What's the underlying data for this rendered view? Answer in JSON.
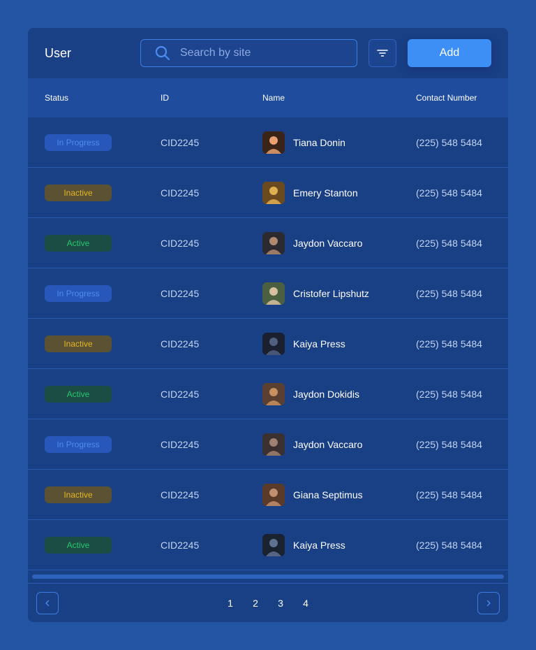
{
  "header": {
    "title": "User",
    "search_placeholder": "Search by site",
    "add_label": "Add"
  },
  "table": {
    "columns": [
      "Status",
      "ID",
      "Name",
      "Contact Number"
    ],
    "rows": [
      {
        "status": "In Progress",
        "status_type": "progress",
        "id": "CID2245",
        "name": "Tiana Donin",
        "contact": "(225) 548 5484"
      },
      {
        "status": "Inactive",
        "status_type": "inactive",
        "id": "CID2245",
        "name": "Emery Stanton",
        "contact": "(225) 548 5484"
      },
      {
        "status": "Active",
        "status_type": "active",
        "id": "CID2245",
        "name": "Jaydon Vaccaro",
        "contact": "(225) 548 5484"
      },
      {
        "status": "In Progress",
        "status_type": "progress",
        "id": "CID2245",
        "name": "Cristofer Lipshutz",
        "contact": "(225) 548 5484"
      },
      {
        "status": "Inactive",
        "status_type": "inactive",
        "id": "CID2245",
        "name": "Kaiya Press",
        "contact": "(225) 548 5484"
      },
      {
        "status": "Active",
        "status_type": "active",
        "id": "CID2245",
        "name": "Jaydon Dokidis",
        "contact": "(225) 548 5484"
      },
      {
        "status": "In Progress",
        "status_type": "progress",
        "id": "CID2245",
        "name": "Jaydon Vaccaro",
        "contact": "(225) 548 5484"
      },
      {
        "status": "Inactive",
        "status_type": "inactive",
        "id": "CID2245",
        "name": "Giana Septimus",
        "contact": "(225) 548 5484"
      },
      {
        "status": "Active",
        "status_type": "active",
        "id": "CID2245",
        "name": "Kaiya Press",
        "contact": "(225) 548 5484"
      }
    ]
  },
  "pagination": {
    "pages": [
      "1",
      "2",
      "3",
      "4"
    ]
  },
  "colors": {
    "background": "#2353a3",
    "card": "#193f85",
    "accent": "#3e8ff5",
    "status_progress": "#4d8cf0",
    "status_inactive": "#e6b525",
    "status_active": "#29c46c"
  },
  "icons": {
    "search": "search-icon",
    "filter": "filter-icon",
    "prev": "chevron-left-icon",
    "next": "chevron-right-icon"
  }
}
